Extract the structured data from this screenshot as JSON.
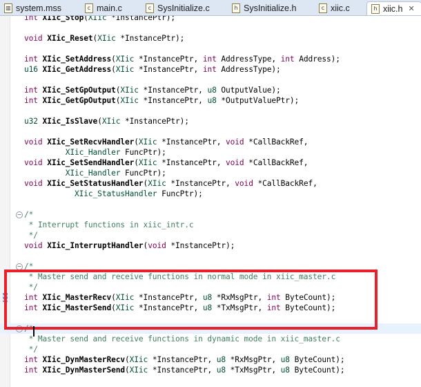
{
  "tabs": [
    {
      "label": "system.mss",
      "icon": "mss-file-icon",
      "active": false
    },
    {
      "label": "main.c",
      "icon": "c-file-icon",
      "active": false
    },
    {
      "label": "SysInitialize.c",
      "icon": "c-file-icon",
      "active": false
    },
    {
      "label": "SysInitialize.h",
      "icon": "h-file-icon",
      "active": false
    },
    {
      "label": "xiic.c",
      "icon": "c-file-icon",
      "active": false
    },
    {
      "label": "xiic.h",
      "icon": "h-file-icon",
      "active": true
    }
  ],
  "colors": {
    "keyword": "#7f0055",
    "type": "#005032",
    "comment": "#3f7f5f",
    "highlight_box": "#e8202a",
    "current_line": "#e8f2fe"
  },
  "code": [
    [
      [
        "k",
        "int "
      ],
      [
        "f",
        "XIic_Stop"
      ],
      [
        "p",
        "("
      ],
      [
        "t",
        "XIic"
      ],
      [
        "p",
        " *InstancePtr);"
      ]
    ],
    [],
    [
      [
        "k",
        "void "
      ],
      [
        "f",
        "XIic_Reset"
      ],
      [
        "p",
        "("
      ],
      [
        "t",
        "XIic"
      ],
      [
        "p",
        " *InstancePtr);"
      ]
    ],
    [],
    [
      [
        "k",
        "int "
      ],
      [
        "f",
        "XIic_SetAddress"
      ],
      [
        "p",
        "("
      ],
      [
        "t",
        "XIic"
      ],
      [
        "p",
        " *InstancePtr, "
      ],
      [
        "k",
        "int"
      ],
      [
        "p",
        " AddressType, "
      ],
      [
        "k",
        "int"
      ],
      [
        "p",
        " Address);"
      ]
    ],
    [
      [
        "t",
        "u16 "
      ],
      [
        "f",
        "XIic_GetAddress"
      ],
      [
        "p",
        "("
      ],
      [
        "t",
        "XIic"
      ],
      [
        "p",
        " *InstancePtr, "
      ],
      [
        "k",
        "int"
      ],
      [
        "p",
        " AddressType);"
      ]
    ],
    [],
    [
      [
        "k",
        "int "
      ],
      [
        "f",
        "XIic_SetGpOutput"
      ],
      [
        "p",
        "("
      ],
      [
        "t",
        "XIic"
      ],
      [
        "p",
        " *InstancePtr, "
      ],
      [
        "t",
        "u8"
      ],
      [
        "p",
        " OutputValue);"
      ]
    ],
    [
      [
        "k",
        "int "
      ],
      [
        "f",
        "XIic_GetGpOutput"
      ],
      [
        "p",
        "("
      ],
      [
        "t",
        "XIic"
      ],
      [
        "p",
        " *InstancePtr, "
      ],
      [
        "t",
        "u8"
      ],
      [
        "p",
        " *OutputValuePtr);"
      ]
    ],
    [],
    [
      [
        "t",
        "u32 "
      ],
      [
        "f",
        "XIic_IsSlave"
      ],
      [
        "p",
        "("
      ],
      [
        "t",
        "XIic"
      ],
      [
        "p",
        " *InstancePtr);"
      ]
    ],
    [],
    [
      [
        "k",
        "void "
      ],
      [
        "f",
        "XIic_SetRecvHandler"
      ],
      [
        "p",
        "("
      ],
      [
        "t",
        "XIic"
      ],
      [
        "p",
        " *InstancePtr, "
      ],
      [
        "k",
        "void"
      ],
      [
        "p",
        " *CallBackRef,"
      ]
    ],
    [
      [
        "p",
        "         "
      ],
      [
        "t",
        "XIic_Handler"
      ],
      [
        "p",
        " FuncPtr);"
      ]
    ],
    [
      [
        "k",
        "void "
      ],
      [
        "f",
        "XIic_SetSendHandler"
      ],
      [
        "p",
        "("
      ],
      [
        "t",
        "XIic"
      ],
      [
        "p",
        " *InstancePtr, "
      ],
      [
        "k",
        "void"
      ],
      [
        "p",
        " *CallBackRef,"
      ]
    ],
    [
      [
        "p",
        "         "
      ],
      [
        "t",
        "XIic_Handler"
      ],
      [
        "p",
        " FuncPtr);"
      ]
    ],
    [
      [
        "k",
        "void "
      ],
      [
        "f",
        "XIic_SetStatusHandler"
      ],
      [
        "p",
        "("
      ],
      [
        "t",
        "XIic"
      ],
      [
        "p",
        " *InstancePtr, "
      ],
      [
        "k",
        "void"
      ],
      [
        "p",
        " *CallBackRef,"
      ]
    ],
    [
      [
        "p",
        "           "
      ],
      [
        "t",
        "XIic_StatusHandler"
      ],
      [
        "p",
        " FuncPtr);"
      ]
    ],
    [],
    [
      [
        "c",
        "/*"
      ]
    ],
    [
      [
        "c",
        " * Interrupt functions in xiic_intr.c"
      ]
    ],
    [
      [
        "c",
        " */"
      ]
    ],
    [
      [
        "k",
        "void "
      ],
      [
        "f",
        "XIic_InterruptHandler"
      ],
      [
        "p",
        "("
      ],
      [
        "k",
        "void"
      ],
      [
        "p",
        " *InstancePtr);"
      ]
    ],
    [],
    [
      [
        "c",
        "/*"
      ]
    ],
    [
      [
        "c",
        " * Master send and receive functions in normal mode in xiic_master.c"
      ]
    ],
    [
      [
        "c",
        " */"
      ]
    ],
    [
      [
        "k",
        "int "
      ],
      [
        "f",
        "XIic_MasterRecv"
      ],
      [
        "p",
        "("
      ],
      [
        "t",
        "XIic"
      ],
      [
        "p",
        " *InstancePtr, "
      ],
      [
        "t",
        "u8"
      ],
      [
        "p",
        " *RxMsgPtr, "
      ],
      [
        "k",
        "int"
      ],
      [
        "p",
        " ByteCount);"
      ]
    ],
    [
      [
        "k",
        "int "
      ],
      [
        "f",
        "XIic_MasterSend"
      ],
      [
        "p",
        "("
      ],
      [
        "t",
        "XIic"
      ],
      [
        "p",
        " *InstancePtr, "
      ],
      [
        "t",
        "u8"
      ],
      [
        "p",
        " *TxMsgPtr, "
      ],
      [
        "k",
        "int"
      ],
      [
        "p",
        " ByteCount);"
      ]
    ],
    [],
    [
      [
        "c",
        "/*"
      ]
    ],
    [
      [
        "c",
        " * Master send and receive functions in dynamic mode in xiic_master.c"
      ]
    ],
    [
      [
        "c",
        " */"
      ]
    ],
    [
      [
        "k",
        "int "
      ],
      [
        "f",
        "XIic_DynMasterRecv"
      ],
      [
        "p",
        "("
      ],
      [
        "t",
        "XIic"
      ],
      [
        "p",
        " *InstancePtr, "
      ],
      [
        "t",
        "u8"
      ],
      [
        "p",
        " *RxMsgPtr, "
      ],
      [
        "t",
        "u8"
      ],
      [
        "p",
        " ByteCount);"
      ]
    ],
    [
      [
        "k",
        "int "
      ],
      [
        "f",
        "XIic_DynMasterSend"
      ],
      [
        "p",
        "("
      ],
      [
        "t",
        "XIic"
      ],
      [
        "p",
        " *InstancePtr, "
      ],
      [
        "t",
        "u8"
      ],
      [
        "p",
        " *TxMsgPtr, "
      ],
      [
        "t",
        "u8"
      ],
      [
        "p",
        " ByteCount);"
      ]
    ]
  ]
}
